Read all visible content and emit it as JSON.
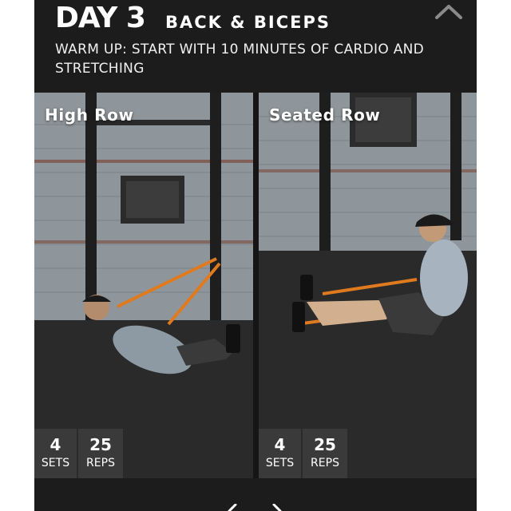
{
  "header": {
    "day": "DAY 3",
    "workout": "BACK & BICEPS",
    "warmup": "WARM UP: START WITH 10 MINUTES OF CARDIO AND STRETCHING",
    "collapse_icon": "chevron-up-icon"
  },
  "exercises": [
    {
      "name": "High Row",
      "sets": "4",
      "sets_label": "SETS",
      "reps": "25",
      "reps_label": "REPS"
    },
    {
      "name": "Seated Row",
      "sets": "4",
      "sets_label": "SETS",
      "reps": "25",
      "reps_label": "REPS"
    }
  ],
  "footer": {
    "prev_icon": "chevron-left-icon",
    "next_icon": "chevron-right-icon"
  },
  "colors": {
    "card_bg": "#1a1a1a",
    "stat_bg": "#3a3a3a",
    "band": "#e07a1f",
    "text": "#ffffff"
  }
}
